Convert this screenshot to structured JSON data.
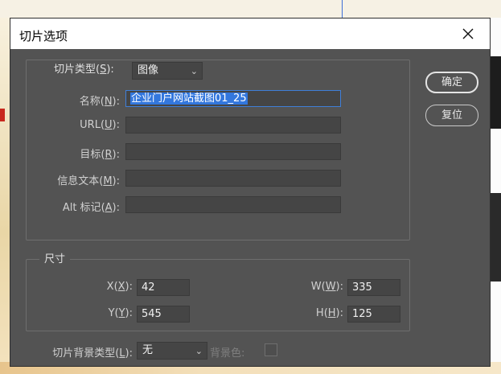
{
  "dialog": {
    "title": "切片选项",
    "close_icon": "close-icon"
  },
  "slice_type": {
    "label": "切片类型",
    "accel": "S",
    "value": "图像"
  },
  "fields": {
    "name": {
      "label": "名称",
      "accel": "N",
      "value": "企业门户网站截图01_25"
    },
    "url": {
      "label": "URL",
      "accel": "U",
      "value": ""
    },
    "target": {
      "label": "目标",
      "accel": "R",
      "value": ""
    },
    "message": {
      "label": "信息文本",
      "accel": "M",
      "value": ""
    },
    "alt": {
      "label": "Alt 标记",
      "accel": "A",
      "value": ""
    }
  },
  "buttons": {
    "ok": "确定",
    "reset": "复位"
  },
  "dimensions": {
    "legend": "尺寸",
    "x": {
      "label": "X",
      "accel": "X",
      "value": "42"
    },
    "y": {
      "label": "Y",
      "accel": "Y",
      "value": "545"
    },
    "w": {
      "label": "W",
      "accel": "W",
      "value": "335"
    },
    "h": {
      "label": "H",
      "accel": "H",
      "value": "125"
    }
  },
  "background": {
    "label": "切片背景类型",
    "accel": "L",
    "value": "无",
    "color_label": "背景色:"
  },
  "colors": {
    "dialog_bg": "#535353",
    "field_bg": "#454545",
    "focus": "#3f7fd8",
    "selection": "#3377dd"
  }
}
